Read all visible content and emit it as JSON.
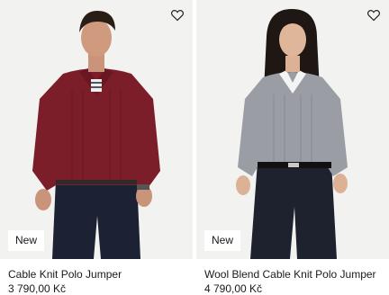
{
  "products": [
    {
      "name": "Cable Knit Polo Jumper",
      "price": "3 790,00 Kč",
      "badge": "New",
      "icon": "heart-outline-icon",
      "sweater_color": "#7c1d2a",
      "trouser_color": "#1c2233"
    },
    {
      "name": "Wool Blend Cable Knit Polo Jumper",
      "price": "4 790,00 Kč",
      "badge": "New",
      "icon": "heart-outline-icon",
      "sweater_color": "#9a9da3",
      "trouser_color": "#1d222e"
    }
  ]
}
